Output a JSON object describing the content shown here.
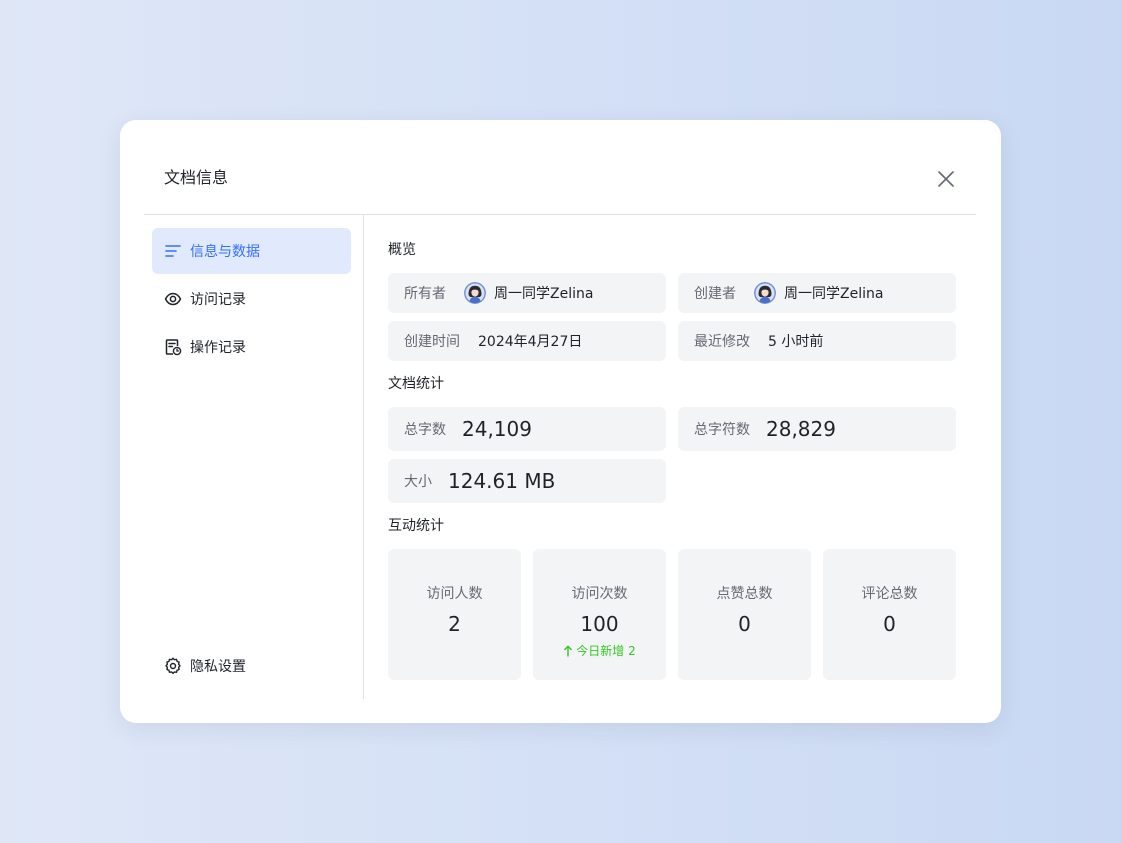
{
  "modal": {
    "title": "文档信息"
  },
  "sidebar": {
    "items": [
      {
        "label": "信息与数据",
        "icon": "list-icon",
        "active": true
      },
      {
        "label": "访问记录",
        "icon": "eye-icon",
        "active": false
      },
      {
        "label": "操作记录",
        "icon": "document-history-icon",
        "active": false
      }
    ],
    "privacy": {
      "label": "隐私设置",
      "icon": "gear-icon"
    }
  },
  "overview": {
    "title": "概览",
    "owner": {
      "label": "所有者",
      "value": "周一同学Zelina"
    },
    "creator": {
      "label": "创建者",
      "value": "周一同学Zelina"
    },
    "created_time": {
      "label": "创建时间",
      "value": "2024年4月27日"
    },
    "last_modified": {
      "label": "最近修改",
      "value": "5 小时前"
    }
  },
  "doc_stats": {
    "title": "文档统计",
    "total_words": {
      "label": "总字数",
      "value": "24,109"
    },
    "total_chars": {
      "label": "总字符数",
      "value": "28,829"
    },
    "size": {
      "label": "大小",
      "value": "124.61 MB"
    }
  },
  "interaction_stats": {
    "title": "互动统计",
    "visitors": {
      "label": "访问人数",
      "value": "2"
    },
    "visits": {
      "label": "访问次数",
      "value": "100",
      "delta": "今日新增 2"
    },
    "likes": {
      "label": "点赞总数",
      "value": "0"
    },
    "comments": {
      "label": "评论总数",
      "value": "0"
    }
  },
  "colors": {
    "accent": "#3370ff",
    "active_bg": "#e1e9fd",
    "card_bg": "#f3f4f6",
    "positive": "#34c724"
  }
}
